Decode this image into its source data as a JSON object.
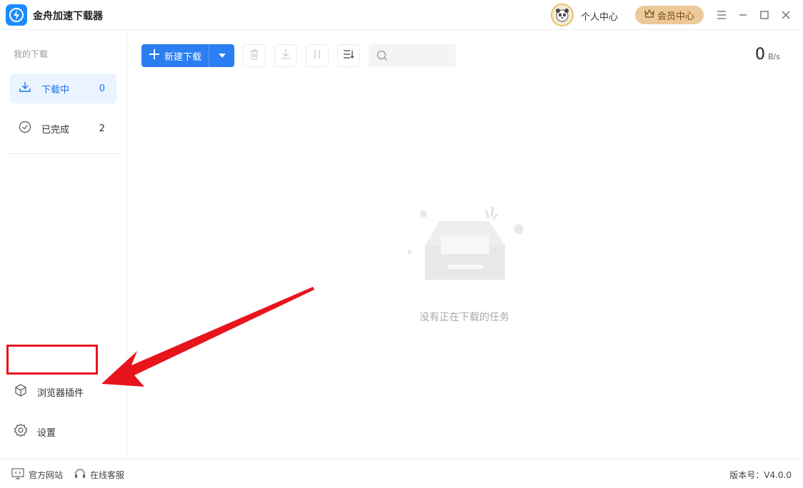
{
  "app": {
    "title": "金舟加速下载器"
  },
  "header": {
    "personal_center": "个人中心",
    "vip_center": "会员中心"
  },
  "sidebar": {
    "section_title": "我的下载",
    "items": [
      {
        "label": "下载中",
        "count": "0"
      },
      {
        "label": "已完成",
        "count": "2"
      }
    ],
    "plugin": "浏览器插件",
    "settings": "设置"
  },
  "toolbar": {
    "new_download": "新建下载",
    "search_placeholder": ""
  },
  "speed": {
    "value": "0",
    "unit": "B/s"
  },
  "empty": {
    "message": "没有正在下载的任务"
  },
  "footer": {
    "website": "官方网站",
    "support": "在线客服",
    "version": "版本号：V4.0.0"
  },
  "colors": {
    "accent": "#2a7ef2",
    "vip": "#ecc99a",
    "highlight": "#e8141c"
  }
}
